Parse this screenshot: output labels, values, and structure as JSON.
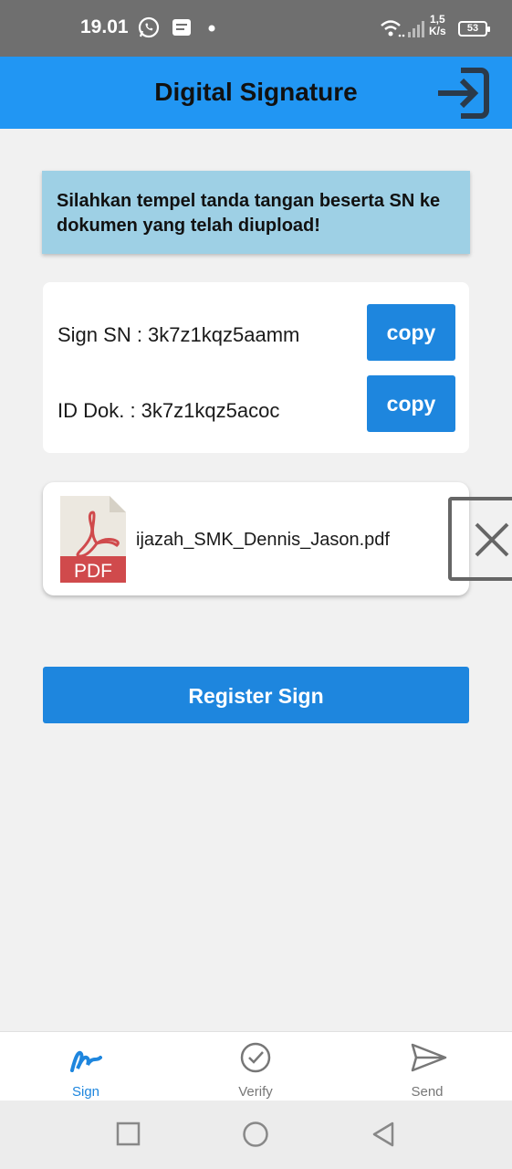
{
  "status_bar": {
    "time": "19.01",
    "net_speed_value": "1,5",
    "net_speed_unit": "K/s",
    "battery": "53"
  },
  "app_bar": {
    "title": "Digital Signature"
  },
  "notice": {
    "text": "Silahkan tempel tanda tangan beserta SN ke dokumen yang telah diupload!"
  },
  "sign_info": {
    "sign_sn": "Sign SN : 3k7z1kqz5aamm",
    "id_dok": "ID Dok. : 3k7z1kqz5acoc",
    "copy_label": "copy"
  },
  "file": {
    "name": "ijazah_SMK_Dennis_Jason.pdf",
    "icon_label": "PDF"
  },
  "register_button": "Register Sign",
  "bottom_nav": {
    "items": [
      {
        "label": "Sign",
        "icon": "sign-icon",
        "active": true
      },
      {
        "label": "Verify",
        "icon": "check-circle-icon",
        "active": false
      },
      {
        "label": "Send",
        "icon": "send-icon",
        "active": false
      }
    ]
  },
  "colors": {
    "app_bar": "#2196f3",
    "accent": "#1e86de",
    "notice_bg": "#9ed0e5",
    "pdf_red": "#d04a4c"
  }
}
